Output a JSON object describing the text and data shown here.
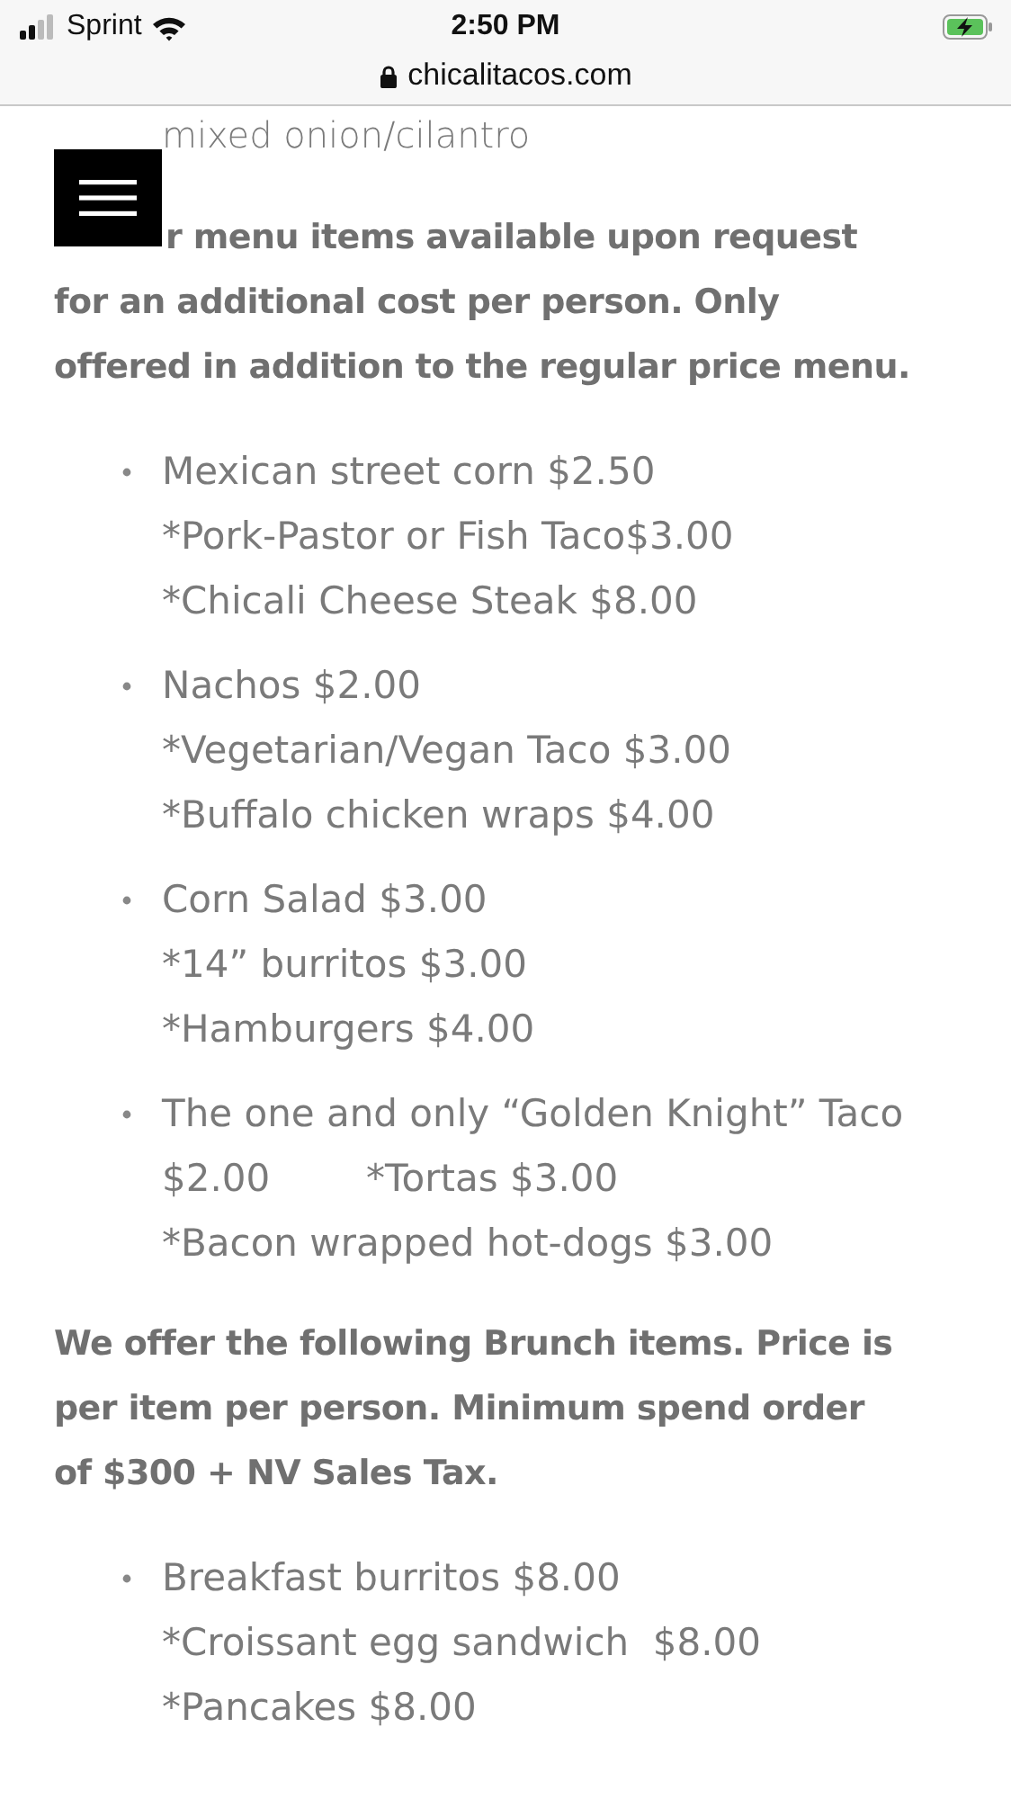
{
  "status_bar": {
    "carrier": "Sprint",
    "time": "2:50 PM",
    "battery_charging": true
  },
  "address_bar": {
    "url": "chicalitacos.com",
    "secure": true
  },
  "content": {
    "lead_line": "mixed onion/cilantro",
    "extras_note": "r menu items available upon request for an additional cost per person. Only offered in addition to the regular price menu.",
    "extras": [
      {
        "lines": [
          "Mexican street corn $2.50",
          "*Pork-Pastor or Fish Taco$3.00",
          "*Chicali Cheese Steak $8.00"
        ]
      },
      {
        "lines": [
          "Nachos $2.00",
          "*Vegetarian/Vegan Taco $3.00",
          "*Buffalo chicken wraps $4.00"
        ]
      },
      {
        "lines": [
          "Corn Salad $3.00",
          "*14” burritos $3.00",
          "*Hamburgers $4.00"
        ]
      },
      {
        "lines": [
          "The one and only “Golden Knight” Taco",
          "$2.00        *Tortas $3.00",
          "*Bacon wrapped hot-dogs $3.00"
        ]
      }
    ],
    "brunch_note": "We offer the following Brunch items. Price is per item per person. Minimum spend order of $300 + NV Sales Tax.",
    "brunch": [
      {
        "lines": [
          "Breakfast burritos $8.00",
          "*Croissant egg sandwich  $8.00",
          "*Pancakes $8.00"
        ]
      }
    ]
  }
}
